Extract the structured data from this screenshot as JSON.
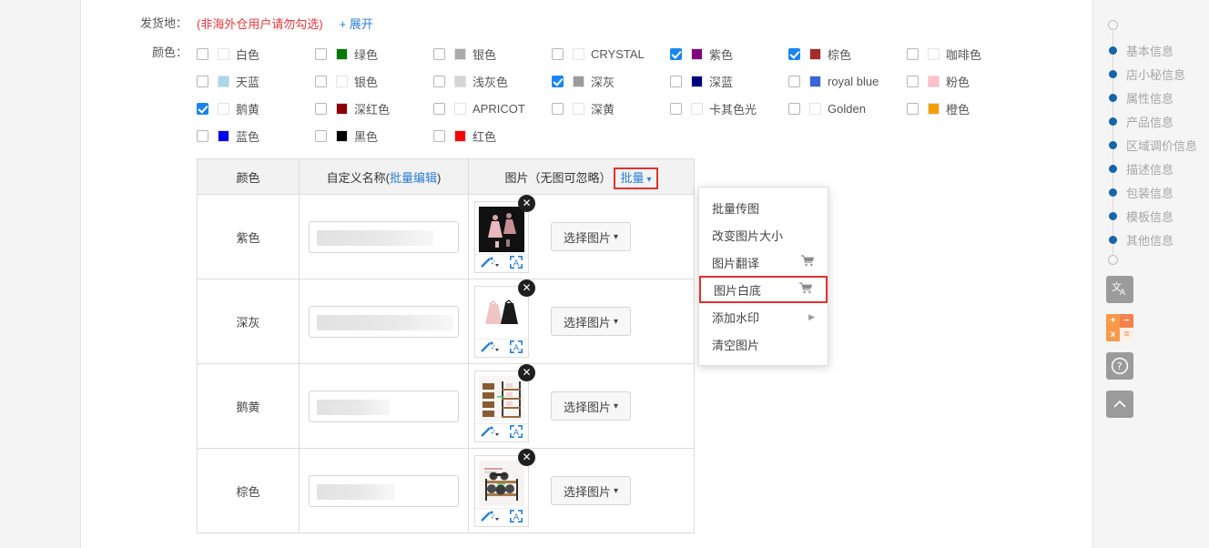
{
  "form": {
    "shipping": {
      "label": "发货地：",
      "note": "(非海外仓用户请勿勾选)",
      "expand_plus": "+",
      "expand_label": "展开"
    },
    "color": {
      "label": "颜色："
    }
  },
  "colors": [
    {
      "name": "白色",
      "swatch": "#ffffff",
      "checked": false
    },
    {
      "name": "绿色",
      "swatch": "#007a00",
      "checked": false
    },
    {
      "name": "银色",
      "swatch": "#aaaaaa",
      "checked": false
    },
    {
      "name": "CRYSTAL",
      "swatch": "#ffffff",
      "checked": false
    },
    {
      "name": "紫色",
      "swatch": "#800080",
      "checked": true
    },
    {
      "name": "棕色",
      "swatch": "#a52a2a",
      "checked": true
    },
    {
      "name": "咖啡色",
      "swatch": "#ffffff",
      "checked": false
    },
    {
      "name": "天蓝",
      "swatch": "#a8d8ec",
      "checked": false
    },
    {
      "name": "银色",
      "swatch": "#ffffff",
      "checked": false
    },
    {
      "name": "浅灰色",
      "swatch": "#d5d5d5",
      "checked": false
    },
    {
      "name": "深灰",
      "swatch": "#9b9b9b",
      "checked": true
    },
    {
      "name": "深蓝",
      "swatch": "#000080",
      "checked": false
    },
    {
      "name": "royal blue",
      "swatch": "#3c63d8",
      "checked": false
    },
    {
      "name": "粉色",
      "swatch": "#ffc0cb",
      "checked": false
    },
    {
      "name": "鹅黄",
      "swatch": "#ffffff",
      "checked": true
    },
    {
      "name": "深红色",
      "swatch": "#8b0000",
      "checked": false
    },
    {
      "name": "APRICOT",
      "swatch": "#ffffff",
      "checked": false
    },
    {
      "name": "深黄",
      "swatch": "#ffffff",
      "checked": false
    },
    {
      "name": "卡其色光",
      "swatch": "#ffffff",
      "checked": false
    },
    {
      "name": "Golden",
      "swatch": "#ffffff",
      "checked": false
    },
    {
      "name": "橙色",
      "swatch": "#f5a000",
      "checked": false
    },
    {
      "name": "蓝色",
      "swatch": "#0000ee",
      "checked": false
    },
    {
      "name": "黑色",
      "swatch": "#000000",
      "checked": false
    },
    {
      "name": "红色",
      "swatch": "#ff0000",
      "checked": false
    }
  ],
  "table": {
    "headers": {
      "color": "颜色",
      "custom_name_prefix": "自定义名称(",
      "custom_name_link": "批量编辑",
      "custom_name_suffix": ")",
      "image": "图片（无图可忽略）",
      "batch_button": "批量"
    },
    "rows": [
      {
        "color": "紫色",
        "name_value": "",
        "redact_width": 128,
        "choose_label": "选择图片",
        "thumb": "party-dress-dark"
      },
      {
        "color": "深灰",
        "name_value": "",
        "redact_width": 150,
        "choose_label": "选择图片",
        "thumb": "two-dresses"
      },
      {
        "color": "鹅黄",
        "name_value": "",
        "redact_width": 80,
        "choose_label": "选择图片",
        "thumb": "wood-shelf"
      },
      {
        "color": "棕色",
        "name_value": "",
        "redact_width": 85,
        "choose_label": "选择图片",
        "thumb": "dumbbell-rack"
      }
    ]
  },
  "batch_menu": {
    "items": [
      {
        "label": "批量传图",
        "cart": false,
        "arrow": false,
        "highlight": false
      },
      {
        "label": "改变图片大小",
        "cart": false,
        "arrow": false,
        "highlight": false
      },
      {
        "label": "图片翻译",
        "cart": true,
        "arrow": false,
        "highlight": false
      },
      {
        "label": "图片白底",
        "cart": true,
        "arrow": false,
        "highlight": true
      },
      {
        "label": "添加水印",
        "cart": false,
        "arrow": true,
        "highlight": false
      },
      {
        "label": "清空图片",
        "cart": false,
        "arrow": false,
        "highlight": false
      }
    ]
  },
  "right_rail": {
    "nav_items": [
      {
        "label": "基本信息"
      },
      {
        "label": "店小秘信息"
      },
      {
        "label": "属性信息"
      },
      {
        "label": "产品信息"
      },
      {
        "label": "区域调价信息"
      },
      {
        "label": "描述信息"
      },
      {
        "label": "包装信息"
      },
      {
        "label": "模板信息"
      },
      {
        "label": "其他信息"
      }
    ],
    "tools": [
      {
        "name": "translate-icon",
        "glyph": "文A"
      },
      {
        "name": "calculator-icon",
        "keys": [
          "+",
          "−",
          "x",
          "="
        ]
      },
      {
        "name": "help-icon",
        "glyph": "?"
      },
      {
        "name": "scroll-top-icon",
        "glyph": "︿"
      }
    ]
  },
  "theme": {
    "accent_blue": "#2a7fd4",
    "checkbox_blue": "#1a85f0",
    "highlight_red": "#e03131",
    "note_red": "#e4393c",
    "rail_dot": "#1565a8"
  }
}
